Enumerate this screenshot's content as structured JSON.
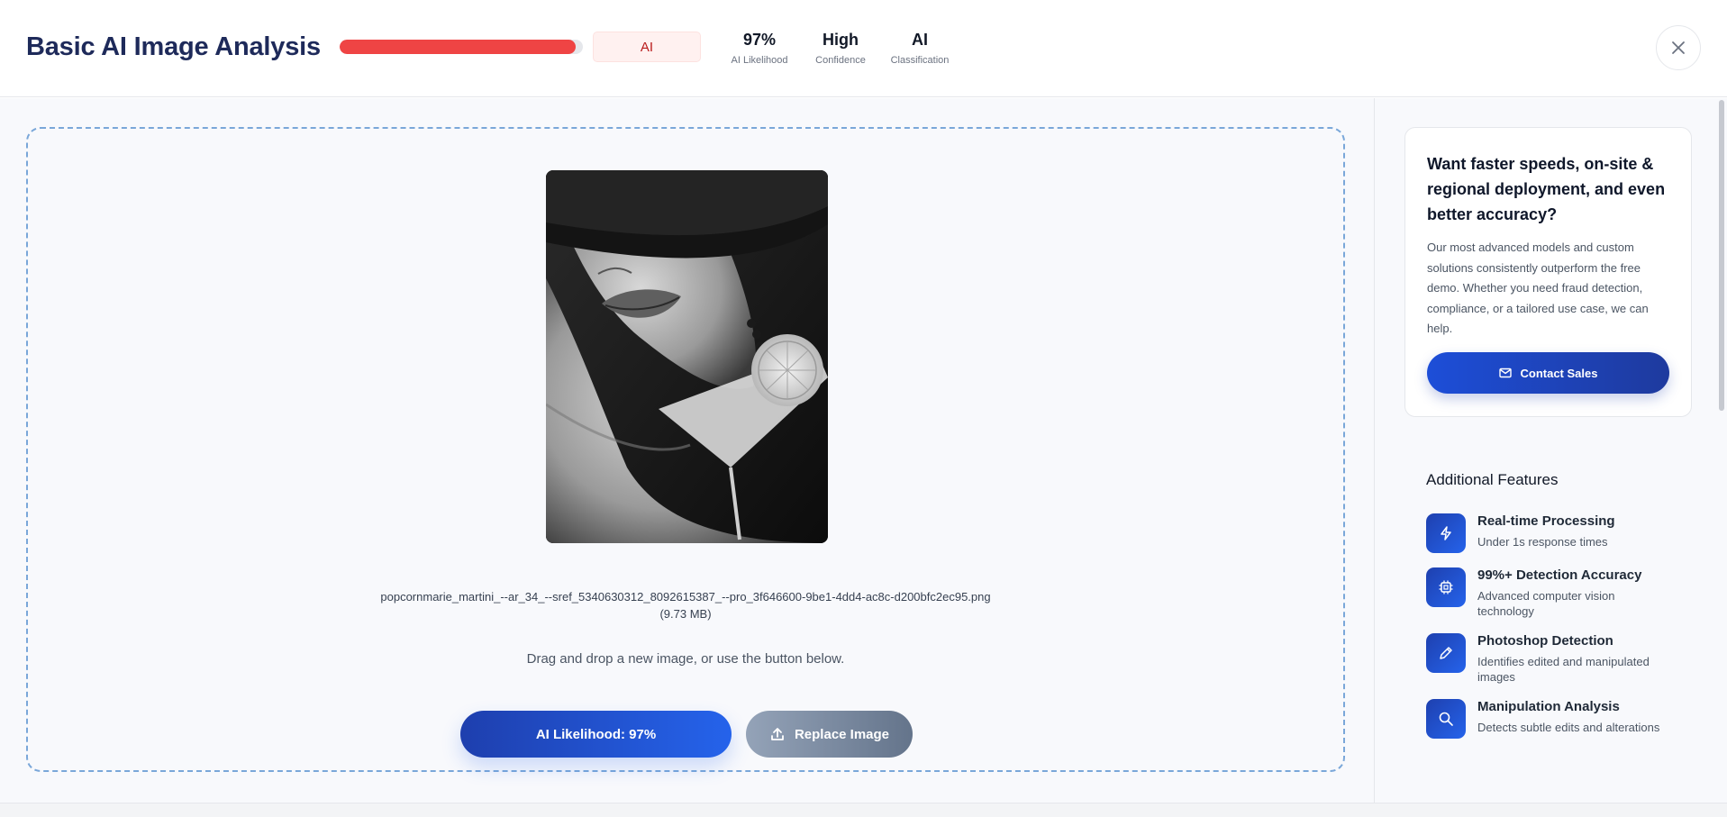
{
  "header": {
    "title": "Basic AI Image Analysis",
    "progress_fraction": 0.97,
    "classification_badge": "AI",
    "stats": [
      {
        "value": "97%",
        "label": "AI Likelihood"
      },
      {
        "value": "High",
        "label": "Confidence"
      },
      {
        "value": "AI",
        "label": "Classification"
      }
    ],
    "close_icon": "close-icon"
  },
  "upload": {
    "filename": "popcornmarie_martini_--ar_34_--sref_5340630312_8092615387_--pro_3f646600-9be1-4dd4-ac8c-d200bfc2ec95.png (9.73 MB)",
    "hint": "Drag and drop a new image, or use the button below.",
    "likelihood_button": "AI Likelihood: 97%",
    "replace_button": "Replace Image"
  },
  "promo": {
    "heading": "Want faster speeds, on-site & regional deployment, and even better accuracy?",
    "body": "Our most advanced models and custom solutions consistently outperform the free demo. Whether you need fraud detection, compliance, or a tailored use case, we can help.",
    "button": "Contact Sales"
  },
  "features": {
    "title": "Additional Features",
    "items": [
      {
        "title": "Real-time Processing",
        "desc": "Under 1s response times",
        "icon": "lightning-icon"
      },
      {
        "title": "99%+ Detection Accuracy",
        "desc": "Advanced computer vision technology",
        "icon": "chip-icon"
      },
      {
        "title": "Photoshop Detection",
        "desc": "Identifies edited and manipulated images",
        "icon": "pencil-icon"
      },
      {
        "title": "Manipulation Analysis",
        "desc": "Detects subtle edits and alterations",
        "icon": "search-icon"
      }
    ]
  },
  "colors": {
    "accent": "#2563eb",
    "danger": "#ef4444",
    "title": "#1e2a5a"
  }
}
